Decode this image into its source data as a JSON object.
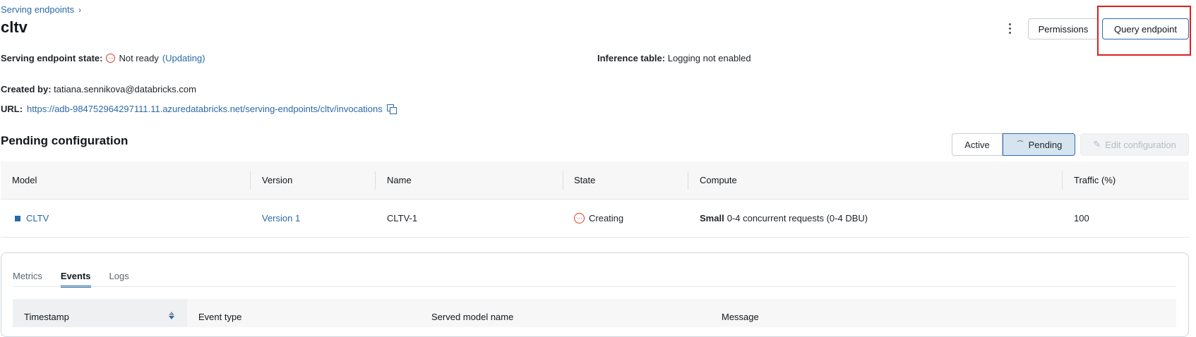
{
  "breadcrumb": {
    "parent": "Serving endpoints",
    "chevron": "›"
  },
  "page": {
    "title": "cltv"
  },
  "header": {
    "permissions_label": "Permissions",
    "query_label": "Query endpoint"
  },
  "status": {
    "state_label": "Serving endpoint state:",
    "state_value": "Not ready",
    "state_detail": "(Updating)",
    "inference_label": "Inference table:",
    "inference_value": "Logging not enabled",
    "created_label": "Created by:",
    "created_value": "tatiana.sennikova@databricks.com",
    "url_label": "URL:",
    "url_value": "https://adb-984752964297111.11.azuredatabricks.net/serving-endpoints/cltv/invocations"
  },
  "config": {
    "title": "Pending configuration",
    "toggle": [
      "Active",
      "Pending"
    ],
    "selected": "Pending",
    "edit_label": "Edit configuration"
  },
  "table": {
    "columns": [
      "Model",
      "Version",
      "Name",
      "State",
      "Compute",
      "Traffic (%)"
    ],
    "rows": [
      {
        "model": "CLTV",
        "version": "Version 1",
        "name": "CLTV-1",
        "state": "Creating",
        "compute_size": "Small",
        "compute_detail": "0-4 concurrent requests (0-4 DBU)",
        "traffic": "100"
      }
    ]
  },
  "tabs": {
    "items": [
      "Metrics",
      "Events",
      "Logs"
    ],
    "active": "Events"
  },
  "events": {
    "columns": [
      "Timestamp",
      "Event type",
      "Served model name",
      "Message"
    ]
  },
  "colors": {
    "accent": "#2a6aa8",
    "error": "#d93b2b",
    "highlight": "#e01e1e"
  },
  "icons": {
    "kebab": "kebab-menu-icon",
    "copy": "copy-icon",
    "state": "not-ready-icon",
    "pencil": "pencil-icon",
    "spinner": "spinner-icon",
    "sort": "sort-icon"
  }
}
